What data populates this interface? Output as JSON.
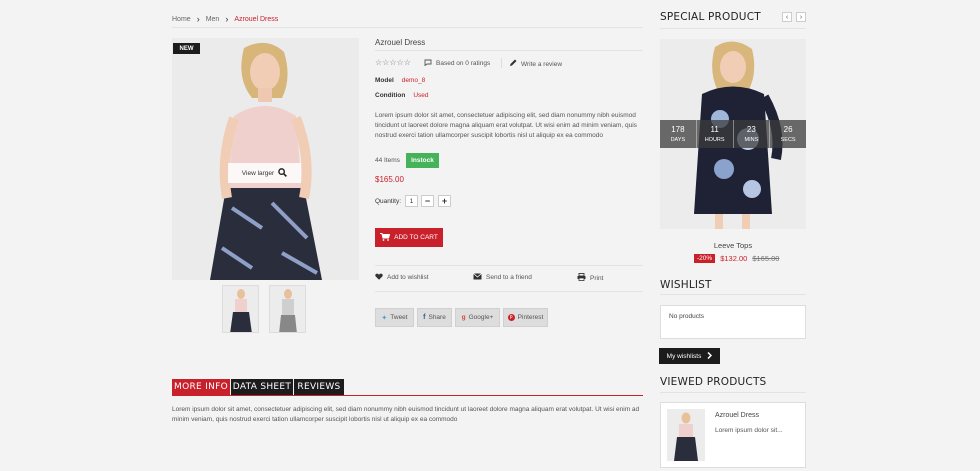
{
  "breadcrumb": {
    "home": "Home",
    "sep": "›",
    "category": "Men",
    "current": "Azrouel Dress"
  },
  "product": {
    "badge": "NEW",
    "view_larger": "View larger",
    "title": "Azrouel Dress",
    "stars": "☆☆☆☆☆",
    "rating_text": "Based on 0 ratings",
    "review_text": "Write a review",
    "model_label": "Model",
    "model_value": "demo_8",
    "condition_label": "Condition",
    "condition_value": "Used",
    "description": "Lorem ipsum dolor sit amet, consectetuer adipiscing elit, sed diam nonummy nibh euismod tincidunt ut laoreet dolore magna aliquam erat volutpat. Ut wisi enim ad minim veniam, quis nostrud exerci tation ullamcorper suscipit lobortis nisl ut aliquip ex ea commodo",
    "stock_count": "44 Items",
    "stock_status": "Instock",
    "price": "$165.00",
    "qty_label": "Quantity:",
    "qty_value": "1",
    "qty_minus": "−",
    "qty_plus": "+",
    "add_to_cart": "ADD TO CART",
    "wishlist": "Add to wishlist",
    "send_friend": "Send to a friend",
    "print": "Print"
  },
  "share": {
    "tweet": "Tweet",
    "facebook": "Share",
    "google": "Google+",
    "pinterest": "Pinterest"
  },
  "tabs": [
    {
      "label": "MORE INFO"
    },
    {
      "label": "DATA SHEET"
    },
    {
      "label": "REVIEWS"
    }
  ],
  "tab_content": "Lorem ipsum dolor sit amet, consectetuer adipiscing elit, sed diam nonummy nibh euismod tincidunt ut laoreet dolore magna aliquam erat volutpat. Ut wisi enim ad minim veniam, quis nostrud exerci tation ullamcorper suscipit lobortis nisl ut aliquip ex ea commodo",
  "special": {
    "title": "SPECIAL PRODUCT",
    "countdown": [
      {
        "n": "178",
        "l": "DAYS"
      },
      {
        "n": "11",
        "l": "HOURS"
      },
      {
        "n": "23",
        "l": "MINS"
      },
      {
        "n": "26",
        "l": "SECS"
      }
    ],
    "name": "Leeve Tops",
    "discount": "-20%",
    "price": "$132.00",
    "old_price": "$165.00"
  },
  "wishlist": {
    "title": "WISHLIST",
    "empty": "No products",
    "button": "My wishlists"
  },
  "viewed": {
    "title": "VIEWED PRODUCTS",
    "name": "Azrouel Dress",
    "desc": "Lorem ipsum dolor sit..."
  },
  "colors": {
    "accent": "#c9212b",
    "dark": "#1c1c1c",
    "instock": "#46b35b"
  }
}
